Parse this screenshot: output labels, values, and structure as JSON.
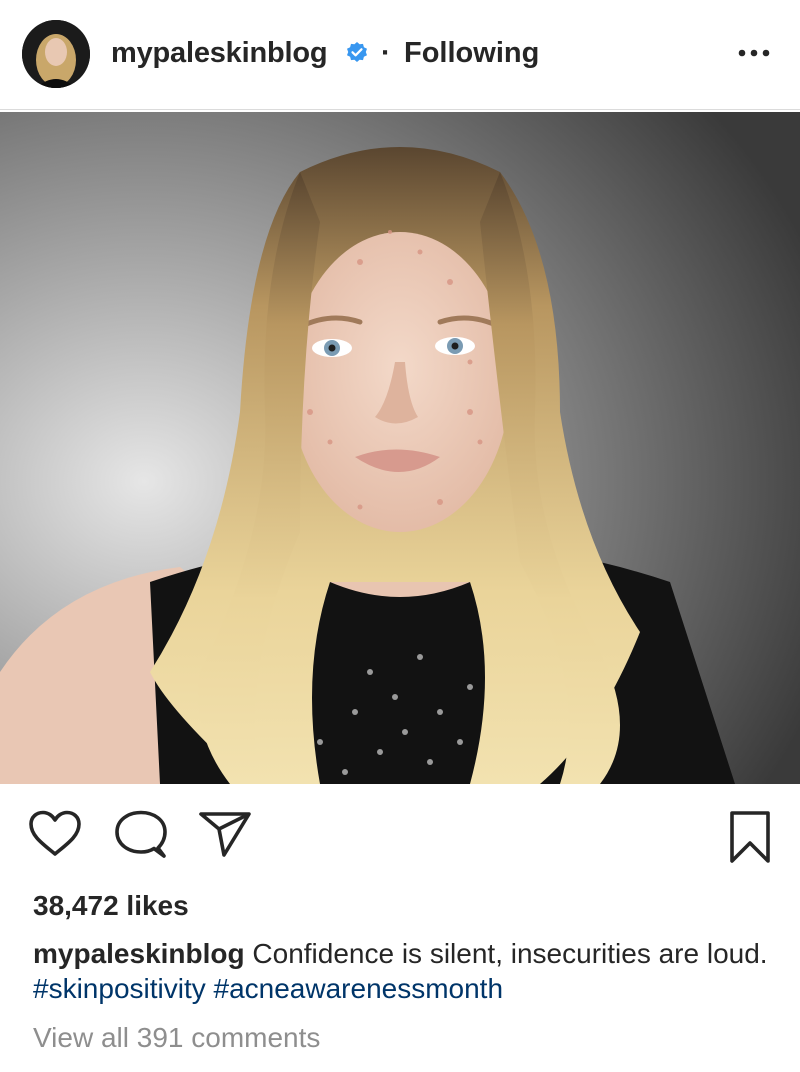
{
  "header": {
    "username": "mypaleskinblog",
    "separator": "·",
    "follow_label": "Following",
    "icons": {
      "verified": "verified-badge-icon",
      "more": "more-options-icon"
    },
    "colors": {
      "verified": "#3897f0"
    }
  },
  "post": {
    "image_alt": "portrait photo",
    "actions": {
      "like": "heart-icon",
      "comment": "comment-icon",
      "share": "paper-plane-icon",
      "save": "bookmark-icon"
    },
    "likes": "38,472 likes",
    "caption": {
      "username": "mypaleskinblog",
      "text": "Confidence is silent, insecurities are loud.",
      "hashtags": [
        "#skinpositivity",
        "#acneawarenessmonth"
      ]
    },
    "view_comments": "View all 391 comments",
    "colors": {
      "hashtag": "#003569",
      "muted": "#8e8e8e"
    }
  }
}
